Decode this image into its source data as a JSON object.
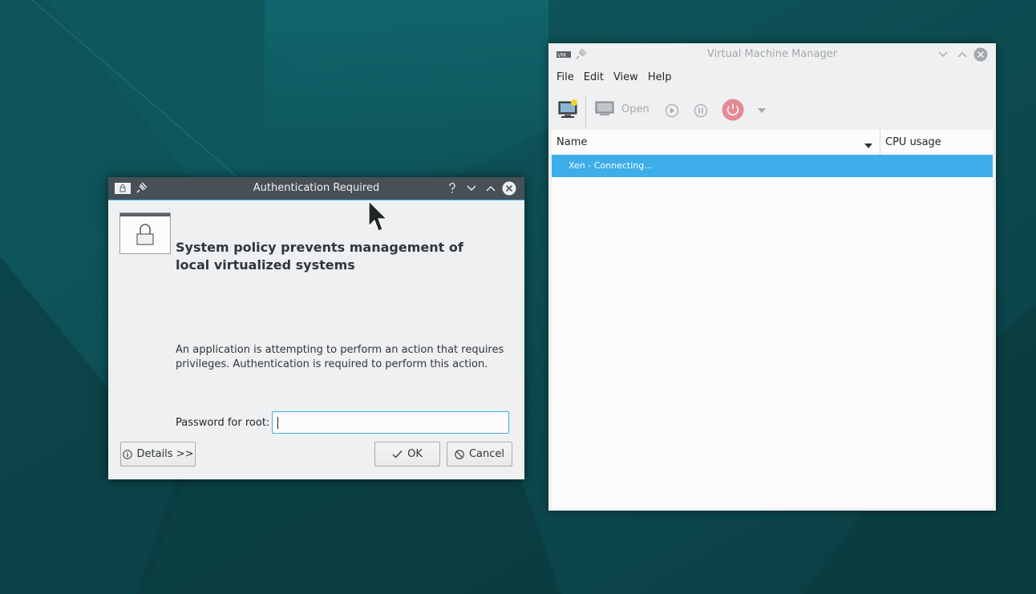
{
  "vmm": {
    "title": "Virtual Machine Manager",
    "menu": [
      "File",
      "Edit",
      "View",
      "Help"
    ],
    "toolbar": {
      "open_label": "Open"
    },
    "columns": {
      "name": "Name",
      "cpu": "CPU usage"
    },
    "rows": [
      {
        "label": "Xen - Connecting...",
        "selected": true
      }
    ]
  },
  "auth": {
    "title": "Authentication Required",
    "heading": "System policy prevents management of local virtualized systems",
    "description": "An application is attempting to perform an action that requires privileges. Authentication is required to perform this action.",
    "password_label": "Password for root:",
    "password_value": "",
    "details_label": "Details >>",
    "ok_label": "OK",
    "cancel_label": "Cancel"
  },
  "colors": {
    "accent": "#3daee9",
    "dialog_titlebar": "#475057",
    "window_bg": "#eff0f1",
    "power_button": "#da4453",
    "desktop": "#0d4e52"
  }
}
